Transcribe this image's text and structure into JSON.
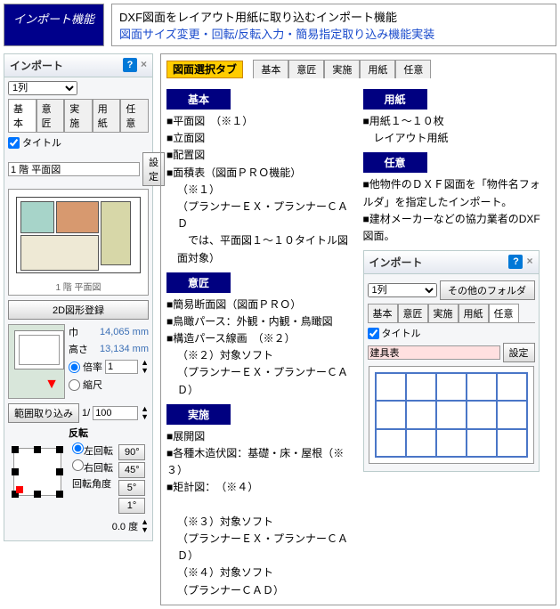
{
  "header": {
    "badge": "インポート機能",
    "desc1": "DXF図面をレイアウト用紙に取り込むインポート機能",
    "desc2": "図面サイズ変更・回転/反転入力・簡易指定取り込み機能実装"
  },
  "panel": {
    "title": "インポート",
    "help": "?",
    "close": "×",
    "col_select": "1列",
    "tabs": [
      "基本",
      "意匠",
      "実施",
      "用紙",
      "任意"
    ],
    "chk_title": "タイトル",
    "title_value": "1 階 平面図",
    "setting_btn": "設定",
    "fp_label": "1 階 平面図",
    "btn2d": "2D図形登録",
    "width_label": "巾",
    "width_value": "14,065 mm",
    "height_label": "高さ",
    "height_value": "13,134 mm",
    "radio_scale": "倍率",
    "scale_value": "1",
    "radio_shukushaku": "縮尺",
    "fit_btn": "範囲取り込み",
    "fit_ratio": "1/",
    "fit_value": "100",
    "hanten": "反転",
    "rot_left": "左回転",
    "rot_right": "右回転",
    "rot_angle": "回転角度",
    "angles": [
      "90°",
      "45°",
      "5°",
      "1°"
    ],
    "cur_angle": "0.0 度"
  },
  "content": {
    "tabrow_label": "図面選択タブ",
    "tabs": [
      "基本",
      "意匠",
      "実施",
      "用紙",
      "任意"
    ],
    "basic": {
      "head": "基本",
      "items": [
        "■平面図　（※１）",
        "■立面図",
        "■配置図",
        "■面積表（図面ＰＲＯ機能）"
      ],
      "note1": "（※１）",
      "note2": "（プランナーＥＸ・プランナーＣＡＤ",
      "note3": "　では、平面図１～１０タイトル図面対象）"
    },
    "isho": {
      "head": "意匠",
      "items": [
        "■簡易断面図（図面ＰＲＯ）",
        "■鳥瞰パース：外観・内観・鳥瞰図",
        "■構造パース線画　（※２）"
      ],
      "note1": "（※２）対象ソフト",
      "note2": "（プランナーＥＸ・プランナーＣＡＤ）"
    },
    "jisshi": {
      "head": "実施",
      "items": [
        "■展開図",
        "■各種木造伏図：基礎・床・屋根（※３）",
        "■矩計図：　（※４）"
      ],
      "note1": "（※３）対象ソフト",
      "note2": "（プランナーＥＸ・プランナーＣＡＤ）",
      "note3": "（※４）対象ソフト",
      "note4": "（プランナーＣＡＤ）"
    },
    "youshi": {
      "head": "用紙",
      "items": [
        "■用紙１～１０枚",
        "　レイアウト用紙"
      ]
    },
    "nini": {
      "head": "任意",
      "items": [
        "■他物件のＤＸＦ図面を「物件名フォルダ」を指定したインポート。",
        "■建材メーカーなどの協力業者のDXF図面。"
      ]
    }
  },
  "mini": {
    "title": "インポート",
    "col": "1列",
    "other": "その他のフォルダ",
    "tabs": [
      "基本",
      "意匠",
      "実施",
      "用紙",
      "任意"
    ],
    "chk_title": "タイトル",
    "title_value": "建具表",
    "setting_btn": "設定"
  }
}
